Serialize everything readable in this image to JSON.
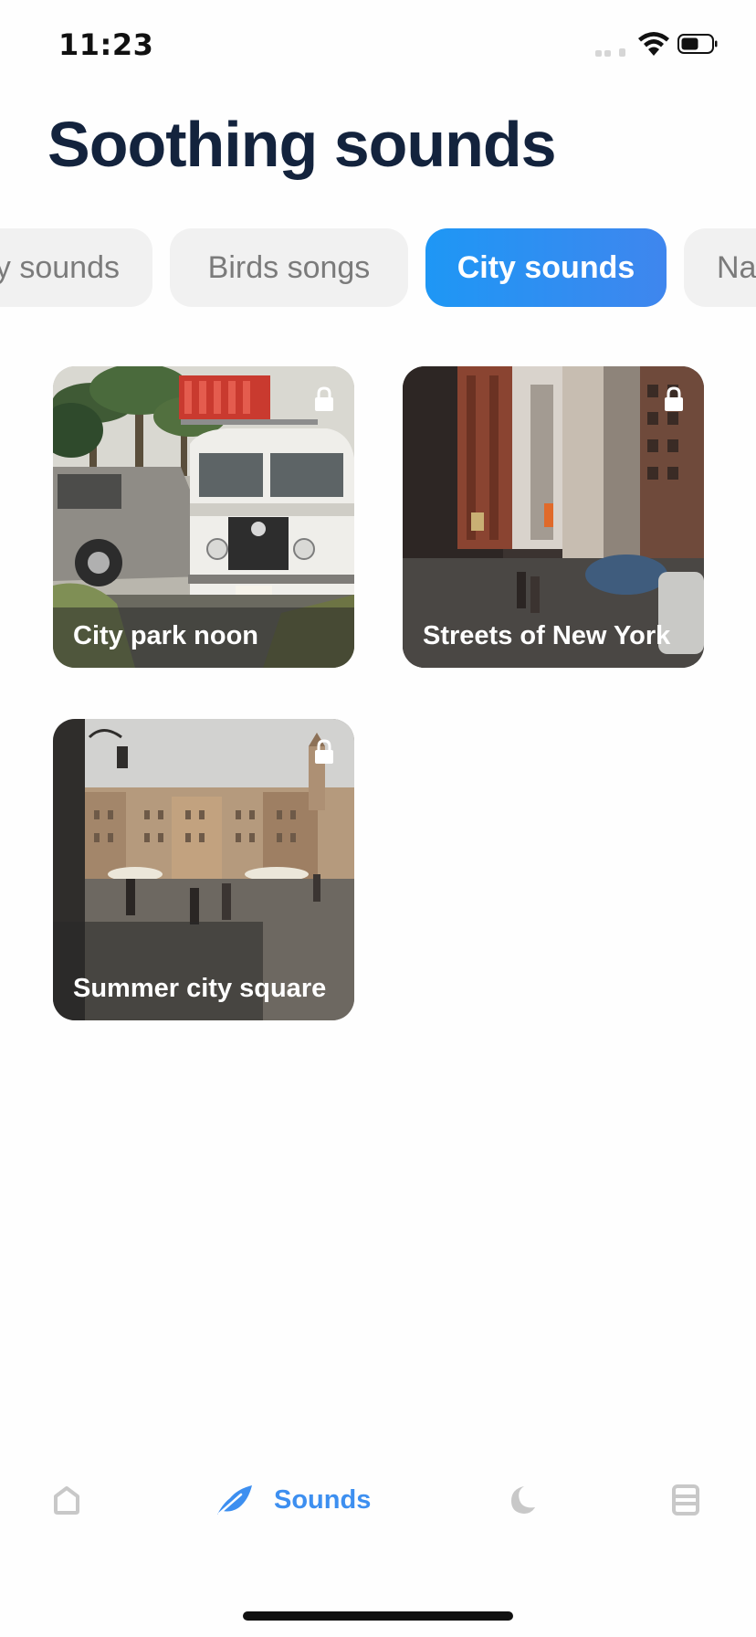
{
  "status_bar": {
    "time": "11:23"
  },
  "page": {
    "title": "Soothing sounds"
  },
  "categories": [
    {
      "label": "y sounds",
      "active": false
    },
    {
      "label": "Birds songs",
      "active": false
    },
    {
      "label": "City sounds",
      "active": true
    },
    {
      "label": "Na",
      "active": false
    }
  ],
  "cards": [
    {
      "title": "City park noon",
      "locked": true,
      "icon": "lock-icon"
    },
    {
      "title": "Streets of New York",
      "locked": true,
      "icon": "lock-icon"
    },
    {
      "title": "Summer city square",
      "locked": true,
      "icon": "lock-icon"
    }
  ],
  "tab_bar": {
    "items": [
      {
        "name": "home",
        "icon": "home-icon",
        "active": false
      },
      {
        "name": "sounds",
        "icon": "feather-icon",
        "label": "Sounds",
        "active": true
      },
      {
        "name": "sleep",
        "icon": "moon-icon",
        "active": false
      },
      {
        "name": "journal",
        "icon": "journal-icon",
        "active": false
      }
    ]
  },
  "colors": {
    "accent": "#3d8ff0",
    "title": "#13233d",
    "chip_bg": "#f1f1f1",
    "chip_text": "#7b7b7b",
    "inactive_icon": "#c8c8c8"
  }
}
